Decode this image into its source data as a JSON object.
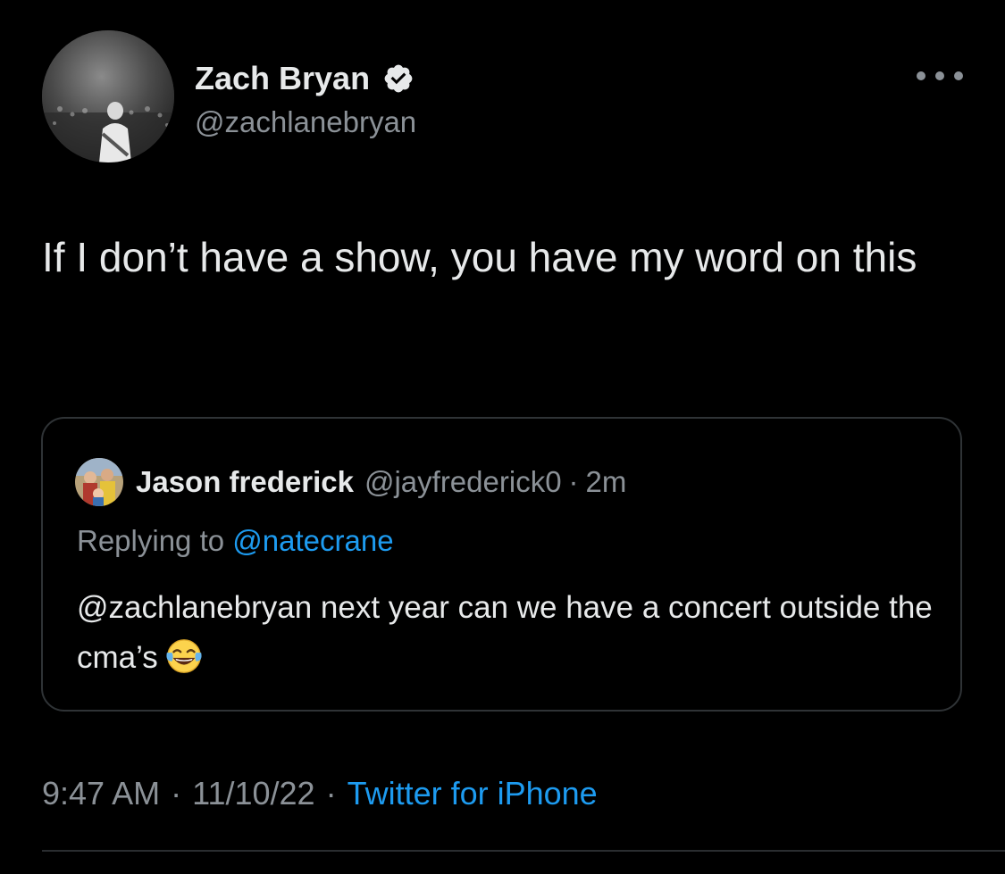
{
  "colors": {
    "background": "#000000",
    "primary_text": "#e7e9ea",
    "secondary_text": "#8b9197",
    "accent": "#1d9bf0",
    "verified_badge": "#e7e9ea",
    "border": "#2f3336"
  },
  "author": {
    "display_name": "Zach Bryan",
    "handle": "@zachlanebryan",
    "verified": true,
    "verified_icon": "verified-badge-icon",
    "avatar_icon": "avatar-concert-photo"
  },
  "more_menu_icon": "more-options-icon",
  "tweet": {
    "text": "If I don’t have a show, you have my word on this"
  },
  "quoted_tweet": {
    "author_name": "Jason frederick",
    "author_handle": "@jayfrederick0",
    "separator": "·",
    "time_ago": "2m",
    "replying_prefix": "Replying to",
    "replying_to": "@natecrane",
    "text": "@zachlanebryan next year can we have a concert outside the cma’s",
    "emoji": "face-with-tears-of-joy-icon",
    "avatar_icon": "avatar-family-photo"
  },
  "meta": {
    "time": "9:47 AM",
    "separator_1": "·",
    "date": "11/10/22",
    "separator_2": "·",
    "source": "Twitter for iPhone"
  }
}
